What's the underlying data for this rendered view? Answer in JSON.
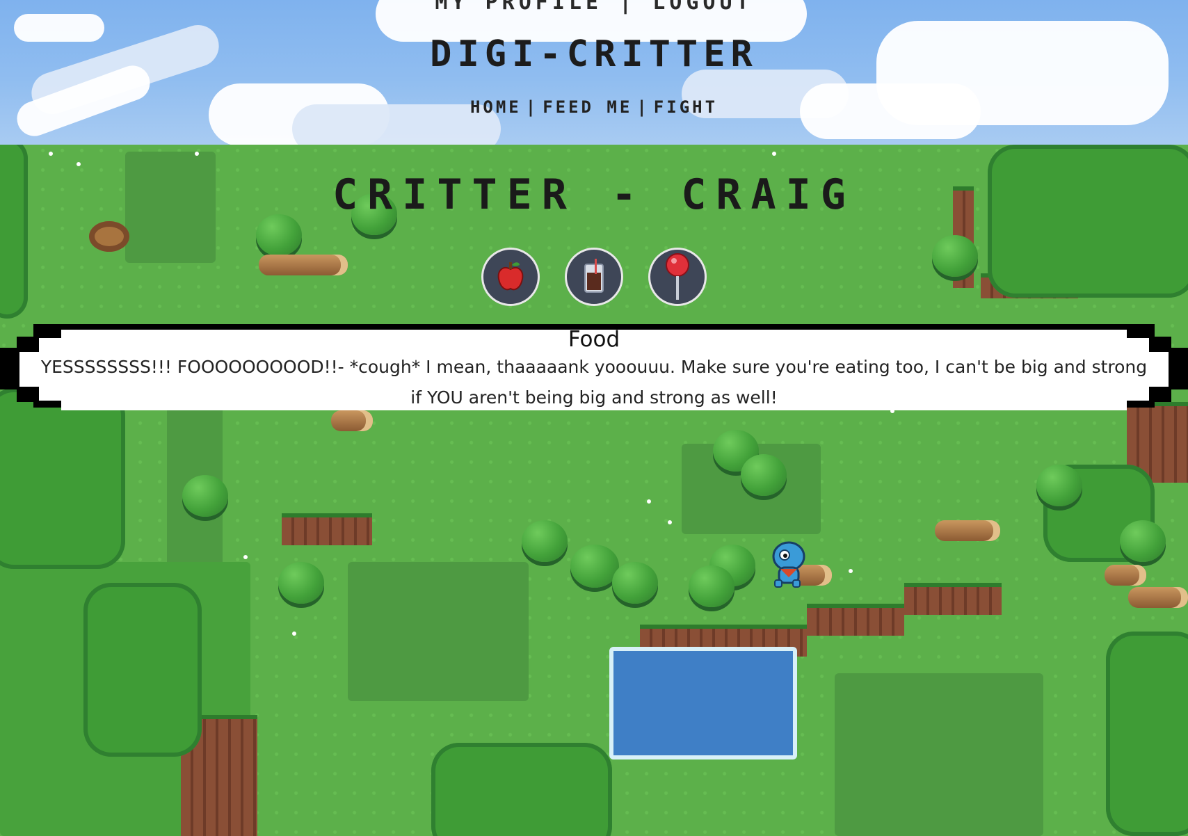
{
  "header": {
    "account_links": "MY PROFILE | LOGOUT",
    "site_title": "DIGI-CRITTER",
    "nav": [
      {
        "label": "HOME"
      },
      {
        "label": "FEED ME"
      },
      {
        "label": "FIGHT"
      }
    ]
  },
  "critter": {
    "title": "CRITTER - CRAIG"
  },
  "actions": [
    {
      "name": "apple",
      "icon": "apple-icon"
    },
    {
      "name": "drink",
      "icon": "cola-glass-icon"
    },
    {
      "name": "toy",
      "icon": "lollipop-icon"
    }
  ],
  "dialog": {
    "title": "Food",
    "text": "YESSSSSSSS!!! FOOOOOOOOOD!!- *cough* I mean, thaaaaank yooouuu. Make sure you're eating too, I can't be big and strong if YOU aren't being big and strong as well!"
  },
  "colors": {
    "sky": "#7fb2ee",
    "grass": "#5cb04a",
    "button_bg": "#3e4657"
  }
}
